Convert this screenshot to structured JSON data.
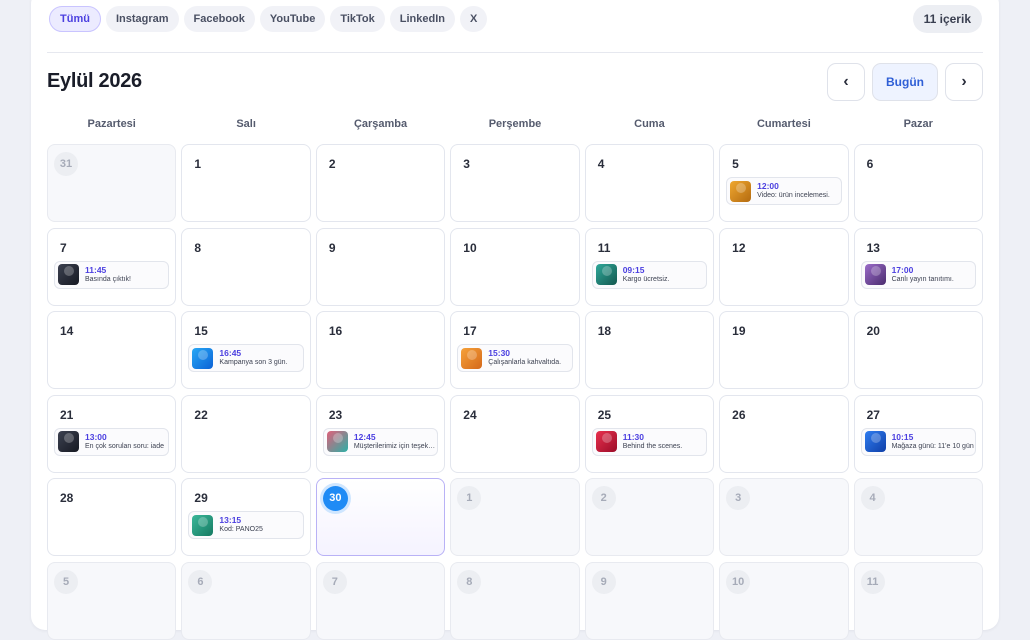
{
  "filters": {
    "chips": [
      {
        "label": "Tümü",
        "active": true
      },
      {
        "label": "Instagram",
        "active": false
      },
      {
        "label": "Facebook",
        "active": false
      },
      {
        "label": "YouTube",
        "active": false
      },
      {
        "label": "TikTok",
        "active": false
      },
      {
        "label": "LinkedIn",
        "active": false
      },
      {
        "label": "X",
        "active": false
      }
    ],
    "count_label": "11 içerik"
  },
  "header": {
    "month_title": "Eylül 2026",
    "prev_label": "‹",
    "today_label": "Bugün",
    "next_label": "›"
  },
  "weekdays": [
    "Pazartesi",
    "Salı",
    "Çarşamba",
    "Perşembe",
    "Cuma",
    "Cumartesi",
    "Pazar"
  ],
  "colors": {
    "accent": "#4b3fe0",
    "today": "#1f8bf5"
  },
  "days": [
    {
      "day": "31",
      "other": true
    },
    {
      "day": "1"
    },
    {
      "day": "2"
    },
    {
      "day": "3"
    },
    {
      "day": "4"
    },
    {
      "day": "5",
      "post": {
        "time": "12:00",
        "title": "Video: ürün incelemesi.",
        "thumb": [
          "#f0a830",
          "#b36a10"
        ]
      }
    },
    {
      "day": "6"
    },
    {
      "day": "7",
      "post": {
        "time": "11:45",
        "title": "Basında çıktık!",
        "thumb": [
          "#3c4150",
          "#161922"
        ]
      }
    },
    {
      "day": "8"
    },
    {
      "day": "9"
    },
    {
      "day": "10"
    },
    {
      "day": "11",
      "post": {
        "time": "09:15",
        "title": "Kargo ücretsiz.",
        "thumb": [
          "#2fa89a",
          "#14584f"
        ]
      }
    },
    {
      "day": "12"
    },
    {
      "day": "13",
      "post": {
        "time": "17:00",
        "title": "Canlı yayın tanıtımı.",
        "thumb": [
          "#9b6cc9",
          "#4a2c6e"
        ]
      }
    },
    {
      "day": "14"
    },
    {
      "day": "15",
      "post": {
        "time": "16:45",
        "title": "Kampanya son 3 gün.",
        "thumb": [
          "#27a8f5",
          "#0c62d6"
        ]
      }
    },
    {
      "day": "16"
    },
    {
      "day": "17",
      "post": {
        "time": "15:30",
        "title": "Çalışanlarla kahvaltıda.",
        "thumb": [
          "#f6a23a",
          "#d4681a"
        ]
      }
    },
    {
      "day": "18"
    },
    {
      "day": "19"
    },
    {
      "day": "20"
    },
    {
      "day": "21",
      "post": {
        "time": "13:00",
        "title": "En çok sorulan soru: iade",
        "thumb": [
          "#3c4150",
          "#161922"
        ]
      }
    },
    {
      "day": "22"
    },
    {
      "day": "23",
      "post": {
        "time": "12:45",
        "title": "Müşterilerimiz için teşekkürler",
        "thumb": [
          "#e0607a",
          "#2cb0a6"
        ]
      }
    },
    {
      "day": "24"
    },
    {
      "day": "25",
      "post": {
        "time": "11:30",
        "title": "Behind the scenes.",
        "thumb": [
          "#e8304e",
          "#9b0c28"
        ]
      }
    },
    {
      "day": "26"
    },
    {
      "day": "27",
      "post": {
        "time": "10:15",
        "title": "Mağaza günü: 11'e 10 gün",
        "thumb": [
          "#2f7df0",
          "#0f3fa8"
        ]
      }
    },
    {
      "day": "28"
    },
    {
      "day": "29",
      "post": {
        "time": "13:15",
        "title": "Kod: PANO25",
        "thumb": [
          "#3bb89a",
          "#167a62"
        ]
      }
    },
    {
      "day": "30",
      "today": true
    },
    {
      "day": "1",
      "other": true
    },
    {
      "day": "2",
      "other": true
    },
    {
      "day": "3",
      "other": true
    },
    {
      "day": "4",
      "other": true
    },
    {
      "day": "5",
      "other": true
    },
    {
      "day": "6",
      "other": true
    },
    {
      "day": "7",
      "other": true
    },
    {
      "day": "8",
      "other": true
    },
    {
      "day": "9",
      "other": true
    },
    {
      "day": "10",
      "other": true
    },
    {
      "day": "11",
      "other": true
    }
  ]
}
